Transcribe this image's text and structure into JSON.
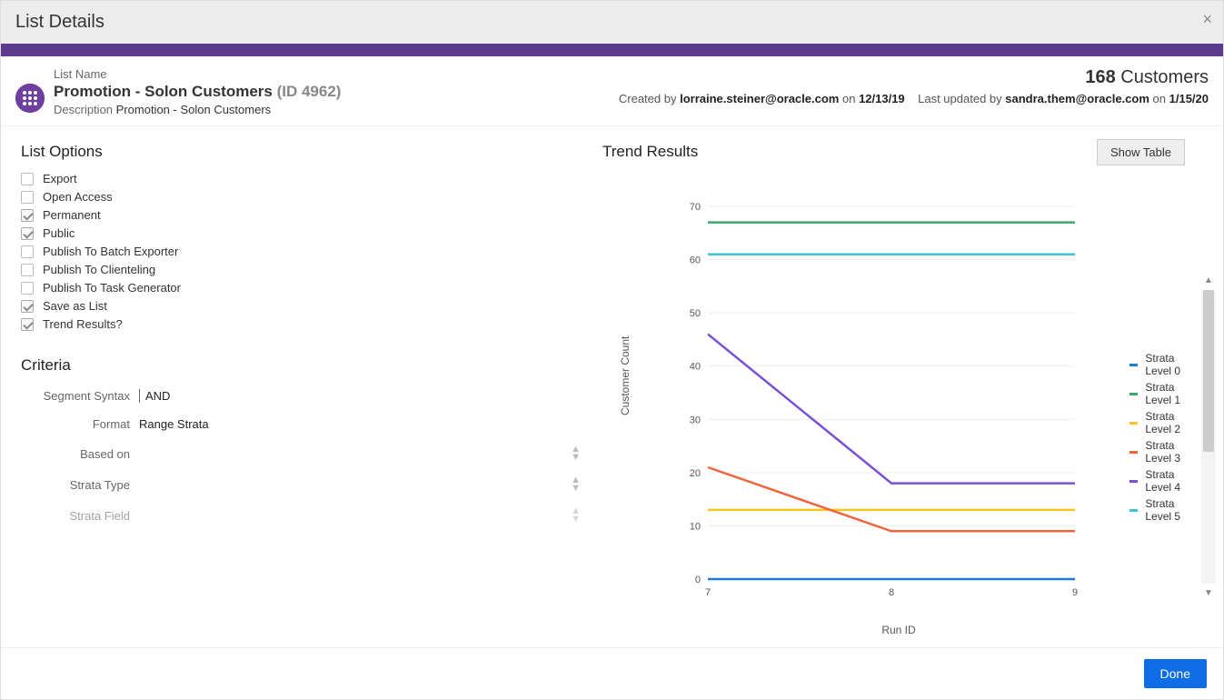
{
  "dialog": {
    "title": "List Details"
  },
  "header": {
    "list_name_label": "List Name",
    "list_name": "Promotion - Solon Customers",
    "list_id_label": "(ID 4962)",
    "description_label": "Description",
    "description_value": "Promotion - Solon Customers",
    "customer_count": "168",
    "customer_count_label": "Customers",
    "created_prefix": "Created by",
    "created_by": "lorraine.steiner@oracle.com",
    "created_on_word": "on",
    "created_date": "12/13/19",
    "updated_prefix": "Last updated by",
    "updated_by": "sandra.them@oracle.com",
    "updated_on_word": "on",
    "updated_date": "1/15/20"
  },
  "list_options": {
    "heading": "List Options",
    "items": [
      {
        "label": "Export",
        "checked": false
      },
      {
        "label": "Open Access",
        "checked": false
      },
      {
        "label": "Permanent",
        "checked": true
      },
      {
        "label": "Public",
        "checked": true
      },
      {
        "label": "Publish To Batch Exporter",
        "checked": false
      },
      {
        "label": "Publish To Clienteling",
        "checked": false
      },
      {
        "label": "Publish To Task Generator",
        "checked": false
      },
      {
        "label": "Save as List",
        "checked": true
      },
      {
        "label": "Trend Results?",
        "checked": true
      }
    ]
  },
  "criteria": {
    "heading": "Criteria",
    "segment_syntax_label": "Segment Syntax",
    "segment_syntax_value": "AND",
    "format_label": "Format",
    "format_value": "Range Strata",
    "based_on_label": "Based on",
    "strata_type_label": "Strata Type",
    "strata_field_label": "Strata Field"
  },
  "trend": {
    "heading": "Trend Results",
    "show_table_label": "Show Table"
  },
  "chart_data": {
    "type": "line",
    "xlabel": "Run ID",
    "ylabel": "Customer Count",
    "x": [
      7,
      8,
      9
    ],
    "ylim": [
      0,
      70
    ],
    "yticks": [
      0,
      10,
      20,
      30,
      40,
      50,
      60,
      70
    ],
    "series": [
      {
        "name": "Strata Level 0",
        "color": "#1f7dd4",
        "values": [
          0,
          0,
          0
        ]
      },
      {
        "name": "Strata Level 1",
        "color": "#3aa76d",
        "values": [
          67,
          67,
          67
        ]
      },
      {
        "name": "Strata Level 2",
        "color": "#f3c623",
        "values": [
          13,
          13,
          13
        ]
      },
      {
        "name": "Strata Level 3",
        "color": "#f0643c",
        "values": [
          21,
          9,
          9
        ]
      },
      {
        "name": "Strata Level 4",
        "color": "#7a4fd6",
        "values": [
          46,
          18,
          18
        ]
      },
      {
        "name": "Strata Level 5",
        "color": "#3fc4cf",
        "values": [
          61,
          61,
          61
        ]
      }
    ]
  },
  "footer": {
    "done_label": "Done"
  }
}
